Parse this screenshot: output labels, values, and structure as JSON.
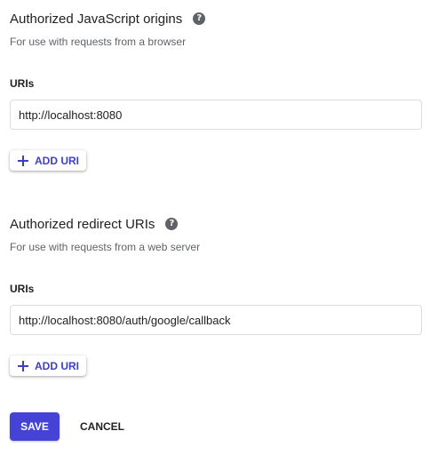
{
  "origins": {
    "title": "Authorized JavaScript origins",
    "help_icon": "?",
    "description": "For use with requests from a browser",
    "field_label": "URIs",
    "uri_value": "http://localhost:8080",
    "add_label": "ADD URI"
  },
  "redirects": {
    "title": "Authorized redirect URIs",
    "help_icon": "?",
    "description": "For use with requests from a web server",
    "field_label": "URIs",
    "uri_value": "http://localhost:8080/auth/google/callback",
    "add_label": "ADD URI"
  },
  "actions": {
    "save_label": "SAVE",
    "cancel_label": "CANCEL"
  },
  "colors": {
    "accent": "#4543d6",
    "text": "#202124",
    "muted": "#5f6368",
    "border": "#dadce0"
  },
  "icons": {
    "help": "help-circle-icon",
    "add": "plus-icon"
  }
}
